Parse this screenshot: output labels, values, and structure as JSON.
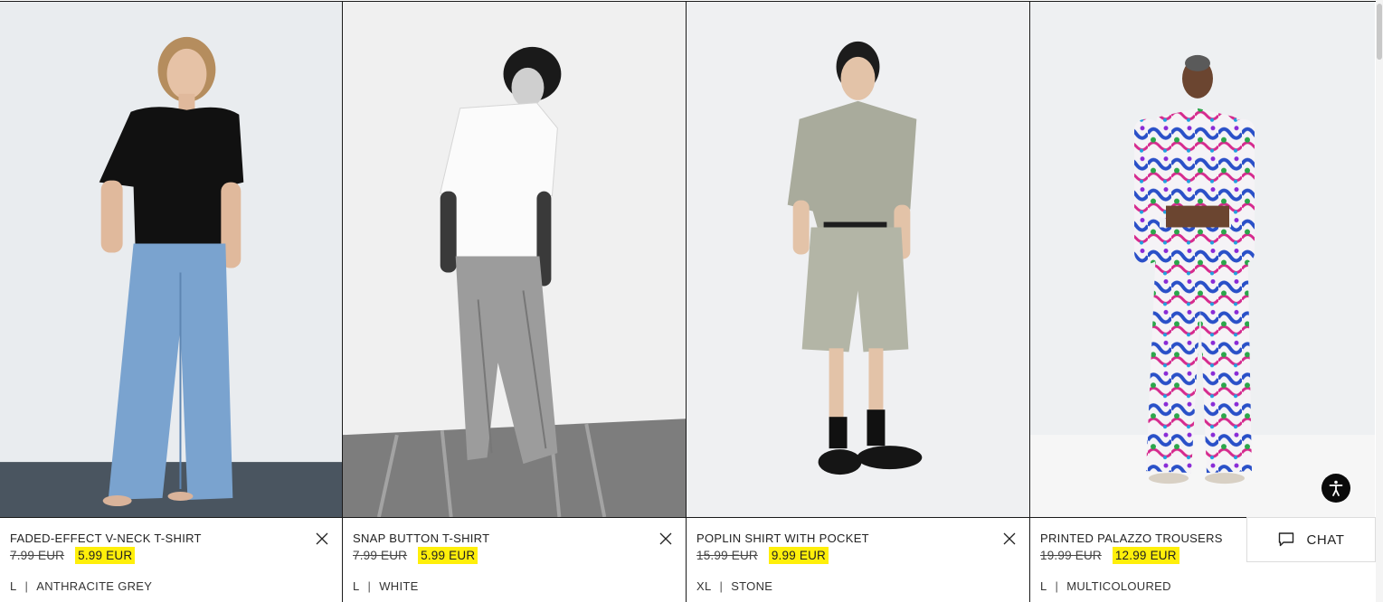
{
  "products": [
    {
      "name": "FADED-EFFECT V-NECK T-SHIRT",
      "old_price": "7.99 EUR",
      "new_price": "5.99 EUR",
      "size": "L",
      "color": "ANTHRACITE GREY",
      "has_remove": true
    },
    {
      "name": "SNAP BUTTON T-SHIRT",
      "old_price": "7.99 EUR",
      "new_price": "5.99 EUR",
      "size": "L",
      "color": "WHITE",
      "has_remove": true
    },
    {
      "name": "POPLIN SHIRT WITH POCKET",
      "old_price": "15.99 EUR",
      "new_price": "9.99 EUR",
      "size": "XL",
      "color": "STONE",
      "has_remove": true
    },
    {
      "name": "PRINTED PALAZZO TROUSERS",
      "old_price": "19.99 EUR",
      "new_price": "12.99 EUR",
      "size": "L",
      "color": "MULTICOLOURED",
      "has_remove": false
    }
  ],
  "separator": "|",
  "chat": {
    "label": "CHAT",
    "icon": "chat-bubble-icon"
  },
  "accessibility": {
    "icon": "accessibility-icon"
  },
  "colors": {
    "sale_highlight": "#ffef0a",
    "border": "#1a1a1a",
    "text": "#222222"
  }
}
